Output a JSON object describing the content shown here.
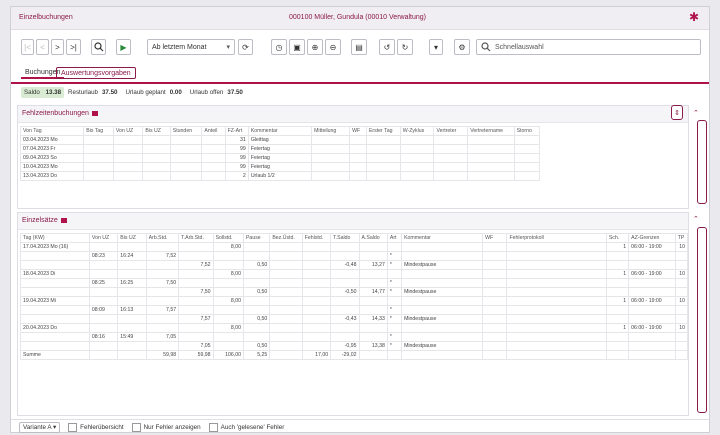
{
  "window": {
    "title_left": "Einzelbuchungen",
    "title_center": "000100 Müller, Gundula (00010 Verwaltung)"
  },
  "toolbar": {
    "month_select": "Ab letztem Monat",
    "search_placeholder": "Schnellauswahl"
  },
  "tabs": [
    {
      "label": "Buchungen"
    },
    {
      "label": "Auswertungsvorgaben"
    }
  ],
  "summary": {
    "saldo_label": "Saldo",
    "saldo_value": "13.38",
    "resturlaub_label": "Resturlaub",
    "resturlaub_value": "37.50",
    "geplant_label": "Urlaub geplant",
    "geplant_value": "0.00",
    "offen_label": "Urlaub offen",
    "offen_value": "37.50"
  },
  "fehlzeiten": {
    "title": "Fehlzeitenbuchungen",
    "columns": [
      "Von Tag",
      "Bis Tag",
      "Von UZ",
      "Bis UZ",
      "Stunden",
      "Anteil",
      "FZ-Art",
      "Kommentar",
      "Mitteilung",
      "WF",
      "Erster Tag",
      "W-Zyklus",
      "Vertreter",
      "Vertretername",
      "Storno"
    ],
    "rows": [
      [
        "03.04.2023 Mo",
        "",
        "",
        "",
        "",
        "",
        "31",
        "Gleittag",
        "",
        "",
        "",
        "",
        "",
        "",
        ""
      ],
      [
        "07.04.2023 Fr",
        "",
        "",
        "",
        "",
        "",
        "99",
        "Feiertag",
        "",
        "",
        "",
        "",
        "",
        "",
        ""
      ],
      [
        "09.04.2023 So",
        "",
        "",
        "",
        "",
        "",
        "99",
        "Feiertag",
        "",
        "",
        "",
        "",
        "",
        "",
        ""
      ],
      [
        "10.04.2023 Mo",
        "",
        "",
        "",
        "",
        "",
        "99",
        "Feiertag",
        "",
        "",
        "",
        "",
        "",
        "",
        ""
      ],
      [
        "13.04.2023 Do",
        "",
        "",
        "",
        "",
        "",
        "2",
        "Urlaub 1/2",
        "",
        "",
        "",
        "",
        "",
        "",
        ""
      ]
    ]
  },
  "einzelsaetze": {
    "title": "Einzelsätze",
    "columns": [
      "Tag (KW)",
      "Von UZ",
      "Bis UZ",
      "Arb.Std.",
      "T.Arb.Std.",
      "Sollstd.",
      "Pause",
      "Bez.Üstd.",
      "Fehlstd.",
      "T.Saldo",
      "A.Saldo",
      "Art",
      "Kommentar",
      "WF",
      "Fehlerprotokoll",
      "Sch.",
      "AZ-Grenzen",
      "TP"
    ],
    "rows": [
      [
        "17.04.2023 Mo (16)",
        "",
        "",
        "",
        "",
        "8,00",
        "",
        "",
        "",
        "",
        "",
        "",
        "",
        "",
        "",
        "1",
        "06:00 - 19:00",
        "10"
      ],
      [
        "",
        "08:23",
        "16:24",
        "7,52",
        "",
        "",
        "",
        "",
        "",
        "",
        "",
        "*",
        "",
        "",
        "",
        "",
        "",
        ""
      ],
      [
        "",
        "",
        "",
        "",
        "7,52",
        "",
        "0,50",
        "",
        "",
        "-0,48",
        "13,27",
        "*",
        "Mindestpause",
        "",
        "",
        "",
        "",
        ""
      ],
      [
        "18.04.2023 Di",
        "",
        "",
        "",
        "",
        "8,00",
        "",
        "",
        "",
        "",
        "",
        "",
        "",
        "",
        "",
        "1",
        "06:00 - 19:00",
        "10"
      ],
      [
        "",
        "08:25",
        "16:25",
        "7,50",
        "",
        "",
        "",
        "",
        "",
        "",
        "",
        "*",
        "",
        "",
        "",
        "",
        "",
        ""
      ],
      [
        "",
        "",
        "",
        "",
        "7,50",
        "",
        "0,50",
        "",
        "",
        "-0,50",
        "14,77",
        "*",
        "Mindestpause",
        "",
        "",
        "",
        "",
        ""
      ],
      [
        "19.04.2023 Mi",
        "",
        "",
        "",
        "",
        "8,00",
        "",
        "",
        "",
        "",
        "",
        "",
        "",
        "",
        "",
        "1",
        "06:00 - 19:00",
        "10"
      ],
      [
        "",
        "08:09",
        "16:13",
        "7,57",
        "",
        "",
        "",
        "",
        "",
        "",
        "",
        "*",
        "",
        "",
        "",
        "",
        "",
        ""
      ],
      [
        "",
        "",
        "",
        "",
        "7,57",
        "",
        "0,50",
        "",
        "",
        "-0,43",
        "14,33",
        "*",
        "Mindestpause",
        "",
        "",
        "",
        "",
        ""
      ],
      [
        "20.04.2023 Do",
        "",
        "",
        "",
        "",
        "8,00",
        "",
        "",
        "",
        "",
        "",
        "",
        "",
        "",
        "",
        "1",
        "06:00 - 19:00",
        "10"
      ],
      [
        "",
        "08:16",
        "15:49",
        "7,05",
        "",
        "",
        "",
        "",
        "",
        "",
        "",
        "*",
        "",
        "",
        "",
        "",
        "",
        ""
      ],
      [
        "",
        "",
        "",
        "",
        "7,05",
        "",
        "0,50",
        "",
        "",
        "-0,95",
        "13,38",
        "*",
        "Mindestpause",
        "",
        "",
        "",
        "",
        ""
      ],
      [
        "Summe",
        "",
        "",
        "59,98",
        "59,98",
        "106,00",
        "5,25",
        "",
        "17,00",
        "-29,02",
        "",
        "",
        "",
        "",
        "",
        "",
        "",
        ""
      ]
    ]
  },
  "footer": {
    "variant": "Variante A",
    "cb1": "Fehlerübersicht",
    "cb2": "Nur Fehler anzeigen",
    "cb3": "Auch 'gelesene' Fehler"
  },
  "colors": {
    "accent": "#b0124a",
    "saldo_bg": "#d9ecd3"
  }
}
